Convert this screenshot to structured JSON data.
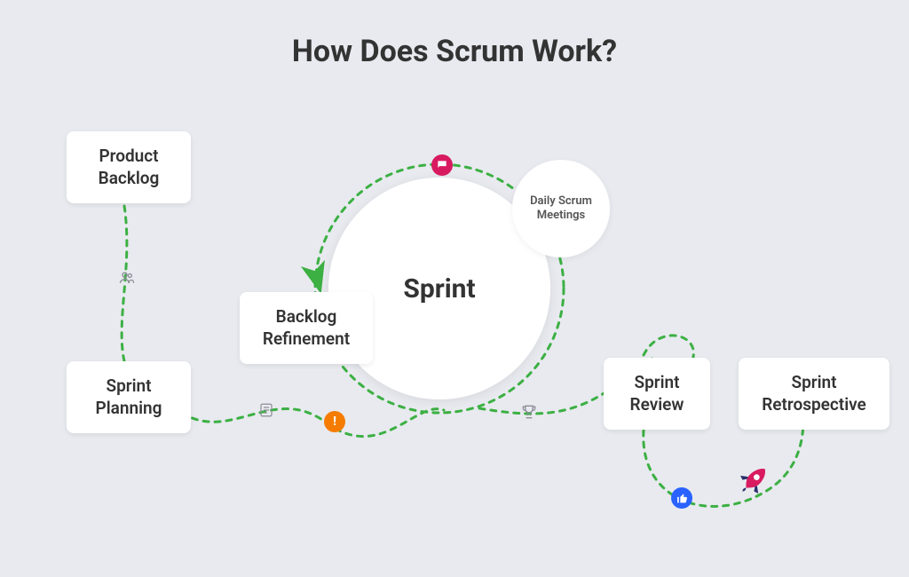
{
  "title": "How Does Scrum Work?",
  "nodes": {
    "product_backlog": "Product\nBacklog",
    "sprint_planning": "Sprint\nPlanning",
    "backlog_refinement": "Backlog\nRefinement",
    "sprint": "Sprint",
    "daily_scrum": "Daily Scrum\nMeetings",
    "sprint_review": "Sprint\nReview",
    "sprint_retro": "Sprint\nRetrospective"
  },
  "colors": {
    "dash": "#3cb043",
    "arrow": "#3cb043",
    "badge_chat": "#d81b60",
    "badge_warn": "#f57c00",
    "badge_like": "#2962ff",
    "rocket_body": "#d81b60",
    "rocket_fin": "#2a2f6b",
    "icon_gray": "#8a8d96"
  }
}
